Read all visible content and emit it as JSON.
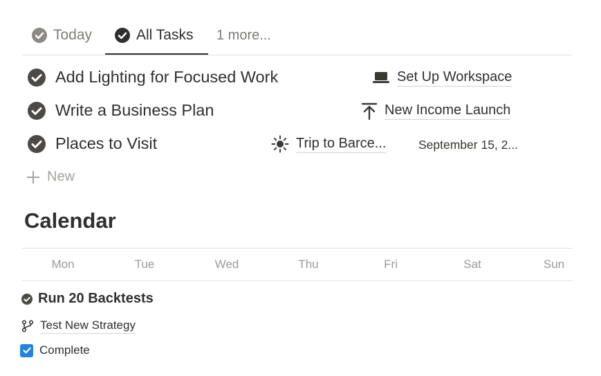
{
  "tabs": [
    {
      "label": "Today"
    },
    {
      "label": "All Tasks"
    },
    {
      "label": "1 more..."
    }
  ],
  "tasks": [
    {
      "title": "Add Lighting for Focused Work",
      "relation": "Set Up Workspace",
      "relation_icon": "laptop-icon"
    },
    {
      "title": "Write a Business Plan",
      "relation": "New Income Launch",
      "relation_icon": "arrow-up-icon"
    },
    {
      "title": "Places to Visit",
      "relation": "Trip to Barce...",
      "relation_icon": "sun-icon",
      "date": "September 15, 2..."
    }
  ],
  "new_label": "New",
  "calendar": {
    "title": "Calendar",
    "weekdays": [
      "Mon",
      "Tue",
      "Wed",
      "Thu",
      "Fri",
      "Sat",
      "Sun"
    ],
    "event": {
      "title": "Run 20 Backtests",
      "relation": "Test New Strategy",
      "relation_icon": "branch-icon",
      "checkbox_label": "Complete",
      "checked": true
    }
  },
  "colors": {
    "text": "#2f2f2f",
    "muted": "#7d7c78",
    "accent_checkbox": "#2383e2",
    "check_circle": "#4b4a47"
  }
}
